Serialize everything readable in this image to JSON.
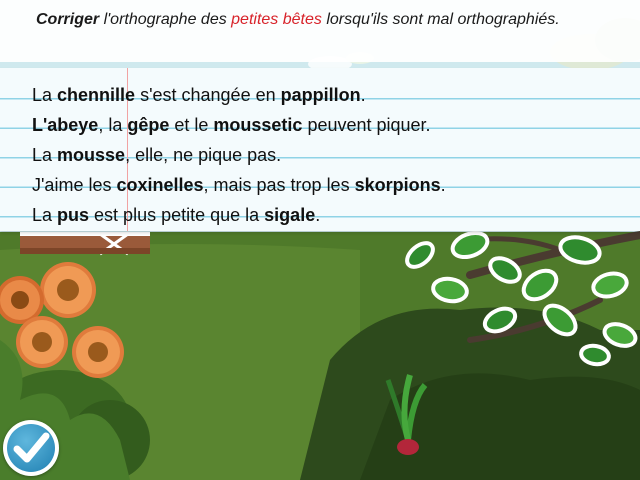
{
  "instruction": {
    "bold": "Corriger",
    "part1": " l'orthographe des ",
    "highlight": "petites bêtes",
    "part2": " lorsqu'ils sont mal orthographiés."
  },
  "sentences": [
    [
      {
        "t": "La ",
        "b": false
      },
      {
        "t": "chennille",
        "b": true
      },
      {
        "t": " s'est changée en ",
        "b": false
      },
      {
        "t": "pappillon",
        "b": true
      },
      {
        "t": ".",
        "b": false
      }
    ],
    [
      {
        "t": "L'abeye",
        "b": true
      },
      {
        "t": ", la ",
        "b": false
      },
      {
        "t": "gêpe",
        "b": true
      },
      {
        "t": " et le ",
        "b": false
      },
      {
        "t": "moussetic",
        "b": true
      },
      {
        "t": " peuvent piquer.",
        "b": false
      }
    ],
    [
      {
        "t": "La ",
        "b": false
      },
      {
        "t": "mousse",
        "b": true
      },
      {
        "t": ", elle, ne pique pas.",
        "b": false
      }
    ],
    [
      {
        "t": "J'aime les ",
        "b": false
      },
      {
        "t": "coxinelles",
        "b": true
      },
      {
        "t": ", mais pas trop les ",
        "b": false
      },
      {
        "t": "skorpions",
        "b": true
      },
      {
        "t": ".",
        "b": false
      }
    ],
    [
      {
        "t": "La ",
        "b": false
      },
      {
        "t": "pus",
        "b": true
      },
      {
        "t": " est plus petite que la ",
        "b": false
      },
      {
        "t": "sigale",
        "b": true
      },
      {
        "t": ".",
        "b": false
      }
    ]
  ],
  "validate_button": {
    "icon": "checkmark-icon"
  },
  "colors": {
    "highlight": "#d8232a",
    "paper_line": "#8fd3e6",
    "margin_line": "#f1a3a3",
    "button": "#2a8cc0"
  }
}
